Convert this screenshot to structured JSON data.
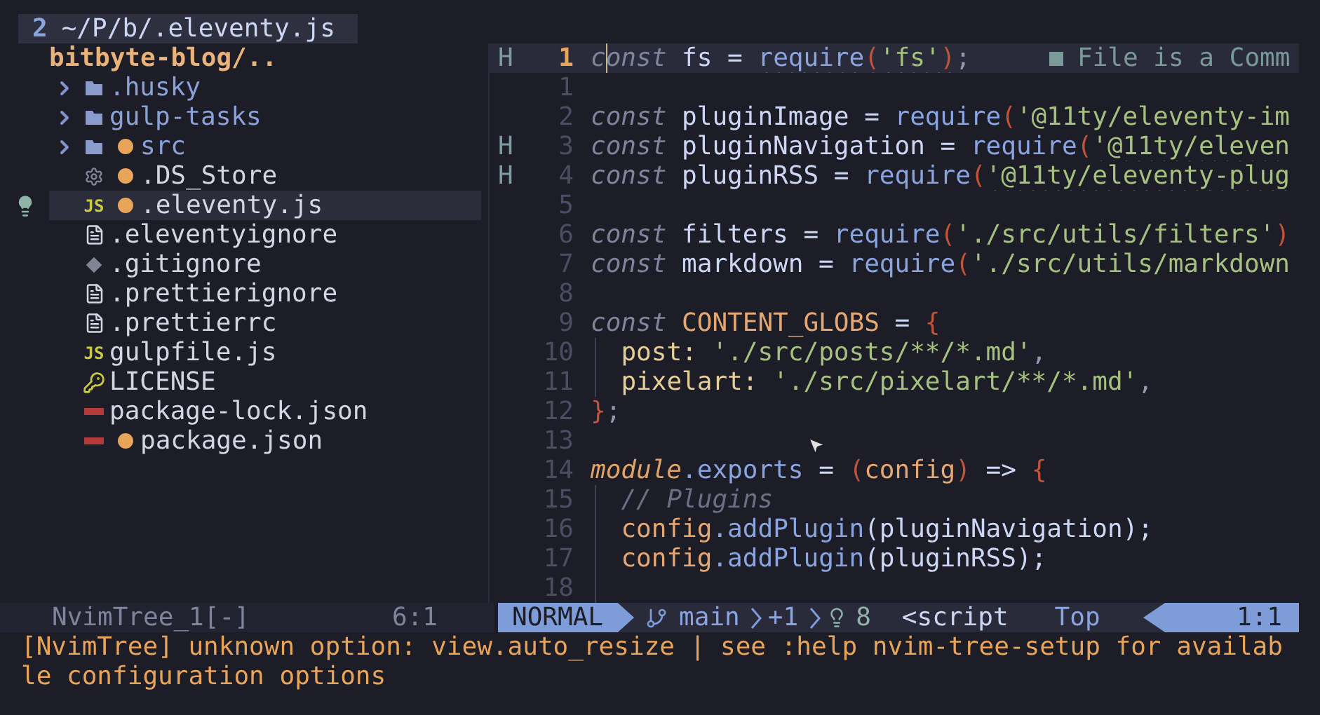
{
  "tabline": {
    "number": "2",
    "path": "~/P/b/.eleventy.js"
  },
  "tree": {
    "root": "bitbyte-blog/..",
    "items": [
      {
        "kind": "folder",
        "name": ".husky",
        "expanded": false,
        "modified": false,
        "selected": false,
        "code_action": false
      },
      {
        "kind": "folder",
        "name": "gulp-tasks",
        "expanded": false,
        "modified": false,
        "selected": false,
        "code_action": false
      },
      {
        "kind": "folder",
        "name": "src",
        "expanded": false,
        "modified": true,
        "selected": false,
        "code_action": false
      },
      {
        "kind": "settings",
        "name": ".DS_Store",
        "modified": true,
        "selected": false,
        "code_action": false
      },
      {
        "kind": "script",
        "icon_label": "JS",
        "name": ".eleventy.js",
        "modified": true,
        "selected": true,
        "code_action": true
      },
      {
        "kind": "document",
        "name": ".eleventyignore",
        "modified": false,
        "selected": false,
        "code_action": false
      },
      {
        "kind": "vcs",
        "name": ".gitignore",
        "modified": false,
        "selected": false,
        "code_action": false
      },
      {
        "kind": "document",
        "name": ".prettierignore",
        "modified": false,
        "selected": false,
        "code_action": false
      },
      {
        "kind": "document",
        "name": ".prettierrc",
        "modified": false,
        "selected": false,
        "code_action": false
      },
      {
        "kind": "script",
        "icon_label": "JS",
        "name": "gulpfile.js",
        "modified": false,
        "selected": false,
        "code_action": false
      },
      {
        "kind": "license",
        "name": "LICENSE",
        "modified": false,
        "selected": false,
        "code_action": false
      },
      {
        "kind": "package",
        "name": "package-lock.json",
        "modified": false,
        "selected": false,
        "code_action": false
      },
      {
        "kind": "package",
        "name": "package.json",
        "modified": true,
        "selected": false,
        "code_action": false
      }
    ]
  },
  "editor": {
    "lines": [
      {
        "sign": "H",
        "number": "1",
        "current": true,
        "tokens": [
          {
            "t": "*c*",
            "color": "#7f849c",
            "cursor": true
          },
          {
            "t": "*onst*",
            "color": "#7f849c"
          },
          {
            "t": " fs = ",
            "color": "#cdd6f4"
          },
          {
            "t": "require",
            "color": "#8aa4e0",
            "undercurl": true
          },
          {
            "t": "(",
            "color": "#c0533a",
            "undercurl": true
          },
          {
            "t": "'fs'",
            "color": "#a6c17f",
            "undercurl": true
          },
          {
            "t": ")",
            "color": "#c0533a",
            "undercurl": true
          },
          {
            "t": ";",
            "color": "#9399b2"
          }
        ],
        "hint": "File is a Comm"
      },
      {
        "number": "1",
        "current": false
      },
      {
        "number": "2",
        "current": false,
        "tokens": [
          {
            "t": "*const*",
            "color": "#7f849c"
          },
          {
            "t": " pluginImage = ",
            "color": "#cdd6f4"
          },
          {
            "t": "require",
            "color": "#8aa4e0"
          },
          {
            "t": "(",
            "color": "#c0533a"
          },
          {
            "t": "'@11ty/eleventy-im",
            "color": "#a6c17f"
          }
        ]
      },
      {
        "sign": "H",
        "number": "3",
        "current": false,
        "tokens": [
          {
            "t": "*const*",
            "color": "#7f849c"
          },
          {
            "t": " pluginNavigation = ",
            "color": "#cdd6f4"
          },
          {
            "t": "require",
            "color": "#8aa4e0"
          },
          {
            "t": "(",
            "color": "#c0533a"
          },
          {
            "t": "'@11ty/eleven",
            "color": "#a6c17f",
            "undercurl": true
          }
        ]
      },
      {
        "sign": "H",
        "number": "4",
        "current": false,
        "tokens": [
          {
            "t": "*const*",
            "color": "#7f849c"
          },
          {
            "t": " pluginRSS = ",
            "color": "#cdd6f4"
          },
          {
            "t": "require",
            "color": "#8aa4e0"
          },
          {
            "t": "(",
            "color": "#c0533a"
          },
          {
            "t": "'@11ty/eleventy-plug",
            "color": "#a6c17f",
            "undercurl": true
          }
        ]
      },
      {
        "number": "5",
        "current": false
      },
      {
        "number": "6",
        "current": false,
        "tokens": [
          {
            "t": "*const*",
            "color": "#7f849c"
          },
          {
            "t": " filters = ",
            "color": "#cdd6f4"
          },
          {
            "t": "require",
            "color": "#8aa4e0"
          },
          {
            "t": "(",
            "color": "#c0533a"
          },
          {
            "t": "'./src/utils/filters'",
            "color": "#a6c17f"
          },
          {
            "t": ")",
            "color": "#c0533a"
          }
        ]
      },
      {
        "number": "7",
        "current": false,
        "tokens": [
          {
            "t": "*const*",
            "color": "#7f849c"
          },
          {
            "t": " markdown = ",
            "color": "#cdd6f4"
          },
          {
            "t": "require",
            "color": "#8aa4e0"
          },
          {
            "t": "(",
            "color": "#c0533a"
          },
          {
            "t": "'./src/utils/markdown",
            "color": "#a6c17f"
          }
        ]
      },
      {
        "number": "8",
        "current": false
      },
      {
        "number": "9",
        "current": false,
        "tokens": [
          {
            "t": "*const*",
            "color": "#7f849c"
          },
          {
            "t": " CONTENT_GLOBS",
            "color": "#e5a872"
          },
          {
            "t": " = ",
            "color": "#cdd6f4"
          },
          {
            "t": "{",
            "color": "#c0533a"
          }
        ]
      },
      {
        "number": "10",
        "current": false,
        "indent": true,
        "tokens": [
          {
            "t": "post: ",
            "color": "#e6cf97"
          },
          {
            "t": "'./src/posts/**/*.md'",
            "color": "#a6c17f"
          },
          {
            "t": ",",
            "color": "#9399b2"
          }
        ]
      },
      {
        "number": "11",
        "current": false,
        "indent": true,
        "tokens": [
          {
            "t": "pixelart: ",
            "color": "#e6cf97"
          },
          {
            "t": "'./src/pixelart/**/*.md'",
            "color": "#a6c17f"
          },
          {
            "t": ",",
            "color": "#9399b2"
          }
        ]
      },
      {
        "number": "12",
        "current": false,
        "tokens": [
          {
            "t": "}",
            "color": "#c0533a"
          },
          {
            "t": ";",
            "color": "#9399b2"
          }
        ]
      },
      {
        "number": "13",
        "current": false
      },
      {
        "number": "14",
        "current": false,
        "tokens": [
          {
            "t": "*module*",
            "color": "#e0a468"
          },
          {
            "t": ".exports",
            "color": "#8aa4e0"
          },
          {
            "t": " = ",
            "color": "#cdd6f4"
          },
          {
            "t": "(",
            "color": "#c0533a"
          },
          {
            "t": "config",
            "color": "#e5a872"
          },
          {
            "t": ")",
            "color": "#c0533a"
          },
          {
            "t": " => ",
            "color": "#cdd6f4"
          },
          {
            "t": "{",
            "color": "#c0533a"
          }
        ]
      },
      {
        "number": "15",
        "current": false,
        "indent": true,
        "tokens": [
          {
            "t": "*// Plugins*",
            "color": "#6c7086"
          }
        ]
      },
      {
        "number": "16",
        "current": false,
        "indent": true,
        "tokens": [
          {
            "t": "config",
            "color": "#e5a872"
          },
          {
            "t": ".addPlugin",
            "color": "#8aa4e0"
          },
          {
            "t": "(pluginNavigation);",
            "color": "#cdd6f4"
          }
        ]
      },
      {
        "number": "17",
        "current": false,
        "indent": true,
        "tokens": [
          {
            "t": "config",
            "color": "#e5a872"
          },
          {
            "t": ".addPlugin",
            "color": "#8aa4e0"
          },
          {
            "t": "(pluginRSS);",
            "color": "#cdd6f4"
          }
        ]
      },
      {
        "number": "18",
        "current": false,
        "indent": true
      }
    ]
  },
  "tree_status": {
    "name": "NvimTree_1[-]",
    "position": "6:1"
  },
  "statusline": {
    "mode": "NORMAL",
    "branch": "main",
    "diff": "+1",
    "diagnostics": "8",
    "filetype": "<script",
    "scroll": "Top",
    "position": "1:1"
  },
  "messages": [
    "[NvimTree] unknown option: view.auto_resize | see :help nvim-tree-setup for availab",
    "le configuration options"
  ]
}
